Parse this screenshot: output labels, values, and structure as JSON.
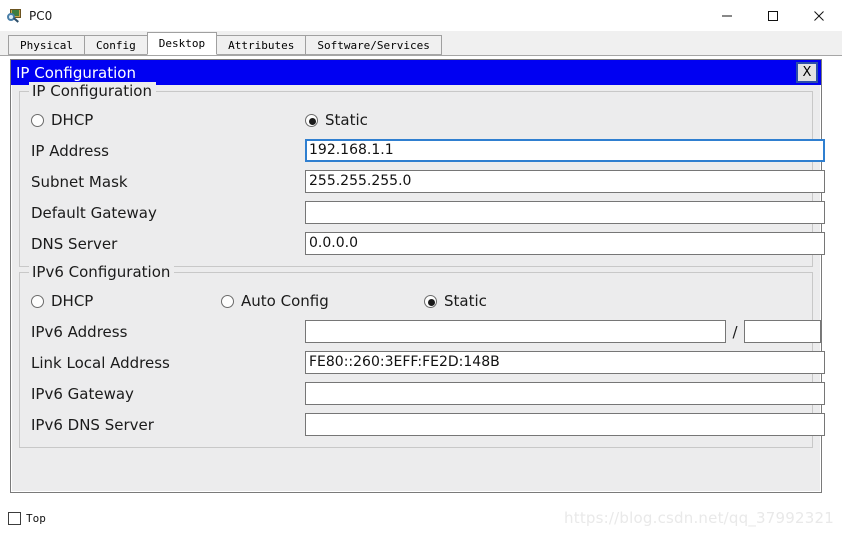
{
  "window": {
    "title": "PC0",
    "icon": "pc-magnifier-icon",
    "controls": {
      "minimize": "minimize-icon",
      "maximize": "maximize-icon",
      "close": "close-icon"
    }
  },
  "tabs": [
    {
      "label": "Physical",
      "active": false
    },
    {
      "label": "Config",
      "active": false
    },
    {
      "label": "Desktop",
      "active": true
    },
    {
      "label": "Attributes",
      "active": false
    },
    {
      "label": "Software/Services",
      "active": false
    }
  ],
  "dialog": {
    "title": "IP Configuration",
    "close_label": "X",
    "title_bg": "#0000f2",
    "title_fg": "#ffffff"
  },
  "ipv4": {
    "group_title": "IP Configuration",
    "modes": [
      {
        "label": "DHCP",
        "selected": false
      },
      {
        "label": "Static",
        "selected": true
      }
    ],
    "fields": [
      {
        "label": "IP Address",
        "value": "192.168.1.1",
        "focused": true
      },
      {
        "label": "Subnet Mask",
        "value": "255.255.255.0",
        "focused": false
      },
      {
        "label": "Default Gateway",
        "value": "",
        "focused": false
      },
      {
        "label": "DNS Server",
        "value": "0.0.0.0",
        "focused": false
      }
    ]
  },
  "ipv6": {
    "group_title": "IPv6 Configuration",
    "modes": [
      {
        "label": "DHCP",
        "selected": false
      },
      {
        "label": "Auto Config",
        "selected": false
      },
      {
        "label": "Static",
        "selected": true
      }
    ],
    "address_row": {
      "label": "IPv6 Address",
      "value": "",
      "separator": "/",
      "prefix_value": ""
    },
    "fields": [
      {
        "label": "Link Local Address",
        "value": "FE80::260:3EFF:FE2D:148B"
      },
      {
        "label": "IPv6 Gateway",
        "value": ""
      },
      {
        "label": "IPv6 DNS Server",
        "value": ""
      }
    ]
  },
  "bottom": {
    "top_checkbox_label": "Top",
    "top_checked": false
  },
  "watermark": {
    "text": "https://blog.csdn.net/qq_37992321"
  }
}
